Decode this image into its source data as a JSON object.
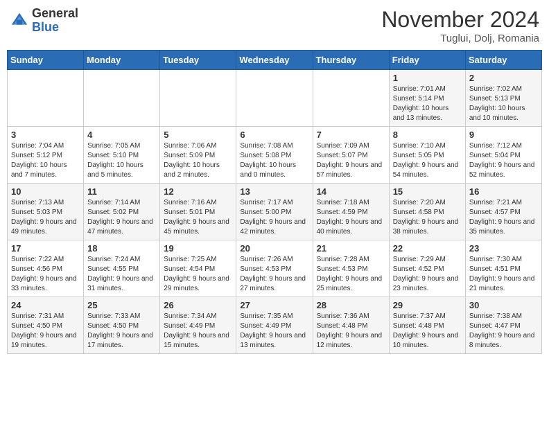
{
  "header": {
    "logo_line1": "General",
    "logo_line2": "Blue",
    "month": "November 2024",
    "location": "Tuglui, Dolj, Romania"
  },
  "weekdays": [
    "Sunday",
    "Monday",
    "Tuesday",
    "Wednesday",
    "Thursday",
    "Friday",
    "Saturday"
  ],
  "weeks": [
    [
      {
        "day": "",
        "info": ""
      },
      {
        "day": "",
        "info": ""
      },
      {
        "day": "",
        "info": ""
      },
      {
        "day": "",
        "info": ""
      },
      {
        "day": "",
        "info": ""
      },
      {
        "day": "1",
        "info": "Sunrise: 7:01 AM\nSunset: 5:14 PM\nDaylight: 10 hours and 13 minutes."
      },
      {
        "day": "2",
        "info": "Sunrise: 7:02 AM\nSunset: 5:13 PM\nDaylight: 10 hours and 10 minutes."
      }
    ],
    [
      {
        "day": "3",
        "info": "Sunrise: 7:04 AM\nSunset: 5:12 PM\nDaylight: 10 hours and 7 minutes."
      },
      {
        "day": "4",
        "info": "Sunrise: 7:05 AM\nSunset: 5:10 PM\nDaylight: 10 hours and 5 minutes."
      },
      {
        "day": "5",
        "info": "Sunrise: 7:06 AM\nSunset: 5:09 PM\nDaylight: 10 hours and 2 minutes."
      },
      {
        "day": "6",
        "info": "Sunrise: 7:08 AM\nSunset: 5:08 PM\nDaylight: 10 hours and 0 minutes."
      },
      {
        "day": "7",
        "info": "Sunrise: 7:09 AM\nSunset: 5:07 PM\nDaylight: 9 hours and 57 minutes."
      },
      {
        "day": "8",
        "info": "Sunrise: 7:10 AM\nSunset: 5:05 PM\nDaylight: 9 hours and 54 minutes."
      },
      {
        "day": "9",
        "info": "Sunrise: 7:12 AM\nSunset: 5:04 PM\nDaylight: 9 hours and 52 minutes."
      }
    ],
    [
      {
        "day": "10",
        "info": "Sunrise: 7:13 AM\nSunset: 5:03 PM\nDaylight: 9 hours and 49 minutes."
      },
      {
        "day": "11",
        "info": "Sunrise: 7:14 AM\nSunset: 5:02 PM\nDaylight: 9 hours and 47 minutes."
      },
      {
        "day": "12",
        "info": "Sunrise: 7:16 AM\nSunset: 5:01 PM\nDaylight: 9 hours and 45 minutes."
      },
      {
        "day": "13",
        "info": "Sunrise: 7:17 AM\nSunset: 5:00 PM\nDaylight: 9 hours and 42 minutes."
      },
      {
        "day": "14",
        "info": "Sunrise: 7:18 AM\nSunset: 4:59 PM\nDaylight: 9 hours and 40 minutes."
      },
      {
        "day": "15",
        "info": "Sunrise: 7:20 AM\nSunset: 4:58 PM\nDaylight: 9 hours and 38 minutes."
      },
      {
        "day": "16",
        "info": "Sunrise: 7:21 AM\nSunset: 4:57 PM\nDaylight: 9 hours and 35 minutes."
      }
    ],
    [
      {
        "day": "17",
        "info": "Sunrise: 7:22 AM\nSunset: 4:56 PM\nDaylight: 9 hours and 33 minutes."
      },
      {
        "day": "18",
        "info": "Sunrise: 7:24 AM\nSunset: 4:55 PM\nDaylight: 9 hours and 31 minutes."
      },
      {
        "day": "19",
        "info": "Sunrise: 7:25 AM\nSunset: 4:54 PM\nDaylight: 9 hours and 29 minutes."
      },
      {
        "day": "20",
        "info": "Sunrise: 7:26 AM\nSunset: 4:53 PM\nDaylight: 9 hours and 27 minutes."
      },
      {
        "day": "21",
        "info": "Sunrise: 7:28 AM\nSunset: 4:53 PM\nDaylight: 9 hours and 25 minutes."
      },
      {
        "day": "22",
        "info": "Sunrise: 7:29 AM\nSunset: 4:52 PM\nDaylight: 9 hours and 23 minutes."
      },
      {
        "day": "23",
        "info": "Sunrise: 7:30 AM\nSunset: 4:51 PM\nDaylight: 9 hours and 21 minutes."
      }
    ],
    [
      {
        "day": "24",
        "info": "Sunrise: 7:31 AM\nSunset: 4:50 PM\nDaylight: 9 hours and 19 minutes."
      },
      {
        "day": "25",
        "info": "Sunrise: 7:33 AM\nSunset: 4:50 PM\nDaylight: 9 hours and 17 minutes."
      },
      {
        "day": "26",
        "info": "Sunrise: 7:34 AM\nSunset: 4:49 PM\nDaylight: 9 hours and 15 minutes."
      },
      {
        "day": "27",
        "info": "Sunrise: 7:35 AM\nSunset: 4:49 PM\nDaylight: 9 hours and 13 minutes."
      },
      {
        "day": "28",
        "info": "Sunrise: 7:36 AM\nSunset: 4:48 PM\nDaylight: 9 hours and 12 minutes."
      },
      {
        "day": "29",
        "info": "Sunrise: 7:37 AM\nSunset: 4:48 PM\nDaylight: 9 hours and 10 minutes."
      },
      {
        "day": "30",
        "info": "Sunrise: 7:38 AM\nSunset: 4:47 PM\nDaylight: 9 hours and 8 minutes."
      }
    ]
  ]
}
